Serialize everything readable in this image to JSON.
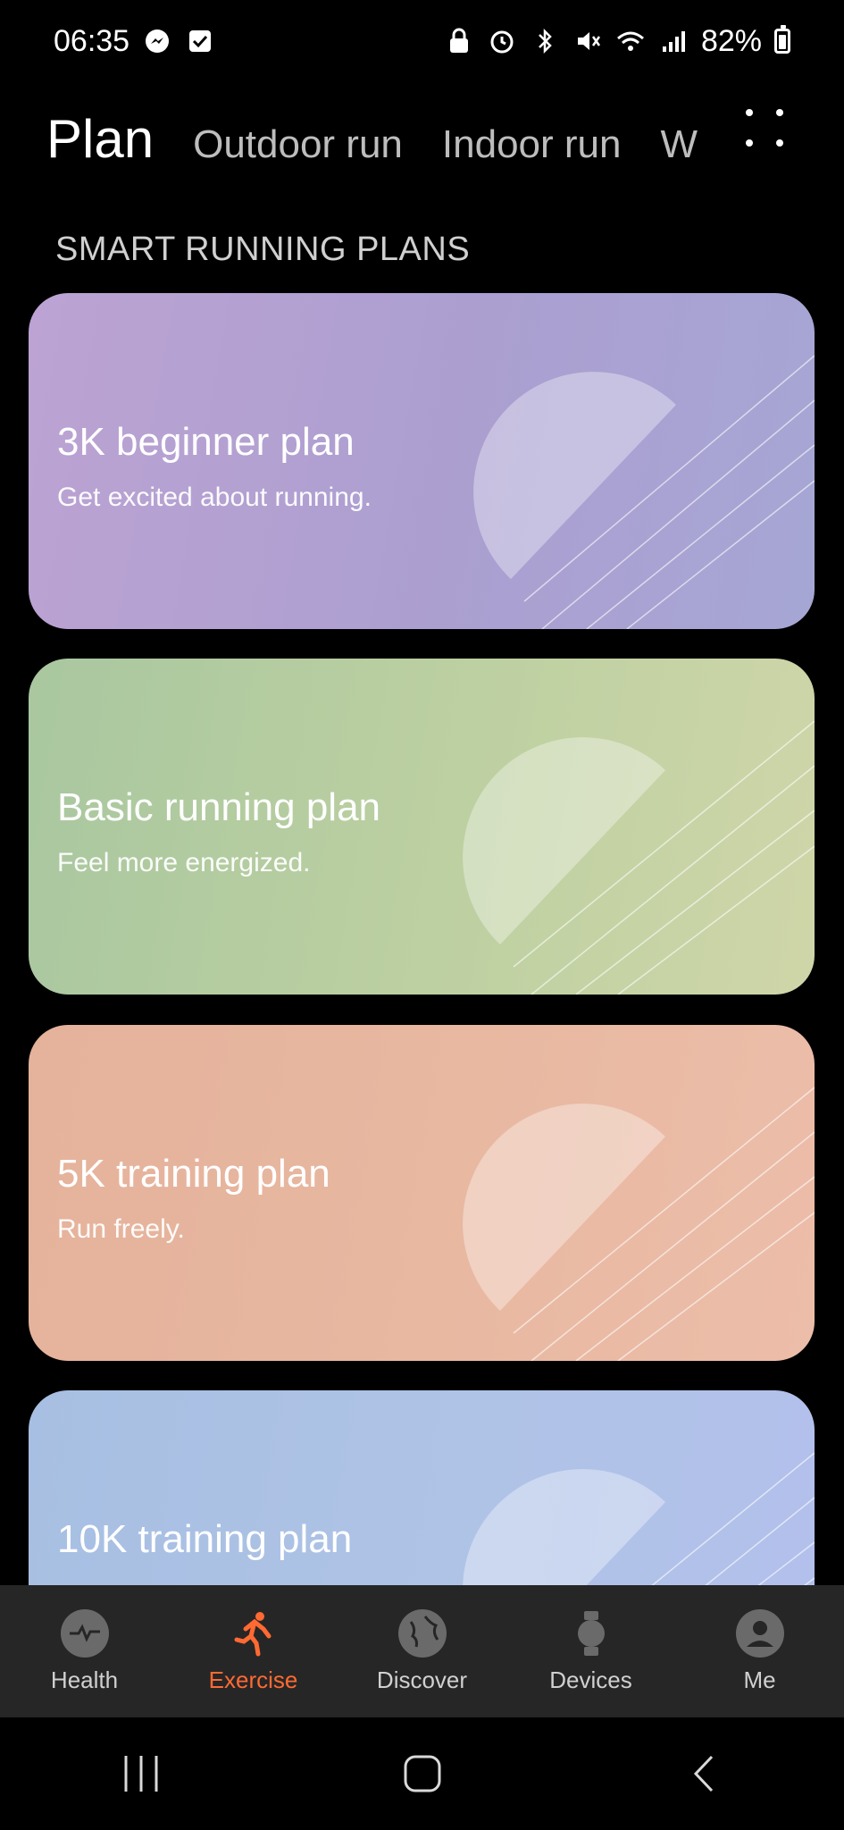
{
  "status": {
    "time": "06:35",
    "battery": "82%"
  },
  "tabs": {
    "items": [
      {
        "label": "Plan"
      },
      {
        "label": "Outdoor run"
      },
      {
        "label": "Indoor run"
      },
      {
        "label": "W"
      }
    ]
  },
  "section": {
    "title": "SMART RUNNING PLANS"
  },
  "cards": [
    {
      "title": "3K beginner plan",
      "subtitle": "Get excited about running."
    },
    {
      "title": "Basic running plan",
      "subtitle": "Feel more energized."
    },
    {
      "title": "5K training plan",
      "subtitle": "Run freely."
    },
    {
      "title": "10K training plan",
      "subtitle": ""
    }
  ],
  "bottom_nav": {
    "items": [
      {
        "label": "Health",
        "icon": "heart-icon"
      },
      {
        "label": "Exercise",
        "icon": "runner-icon"
      },
      {
        "label": "Discover",
        "icon": "globe-icon"
      },
      {
        "label": "Devices",
        "icon": "watch-icon"
      },
      {
        "label": "Me",
        "icon": "person-icon"
      }
    ],
    "active_color": "#ff6a33"
  }
}
